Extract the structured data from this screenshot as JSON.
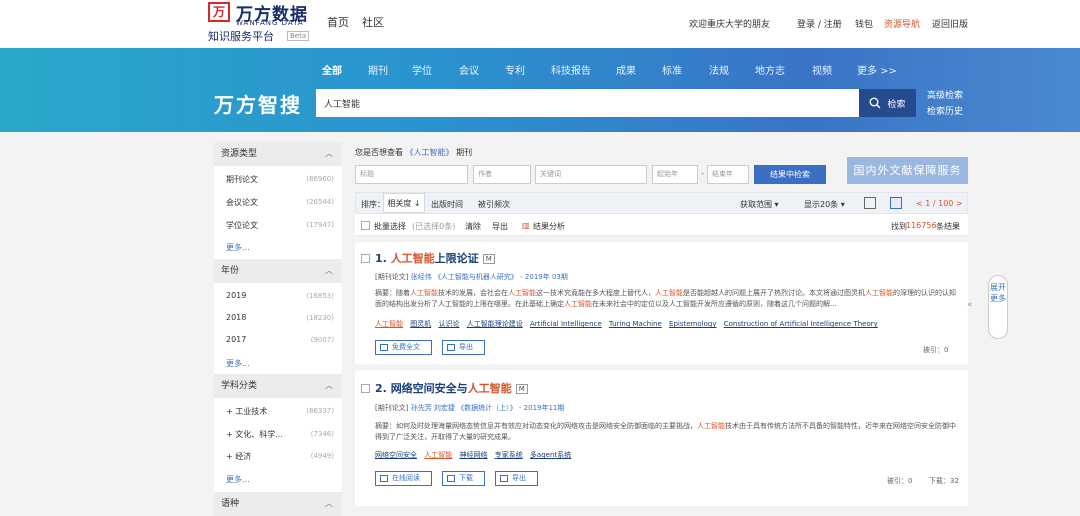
{
  "logo": {
    "mark": "万",
    "cn": "万方数据",
    "en": "WANFANG DATA",
    "sub": "知识服务平台",
    "ver": "Beta"
  },
  "top_nav": [
    "首页",
    "社区"
  ],
  "top_right": {
    "welcome": "欢迎重庆大学的朋友",
    "login": "登录 / 注册",
    "wallet": "钱包",
    "resource": "资源导航",
    "back": "返回旧版"
  },
  "categories": [
    "全部",
    "期刊",
    "学位",
    "会议",
    "专利",
    "科技报告",
    "成果",
    "标准",
    "法规",
    "地方志",
    "视频",
    "更多 >>"
  ],
  "brand": "万方智搜",
  "search": {
    "value": "人工智能",
    "button": "检索",
    "advanced": "高级检索",
    "history": "检索历史"
  },
  "sidebar": {
    "sections": [
      {
        "title": "资源类型",
        "items": [
          {
            "label": "期刊论文",
            "count": "(86960)"
          },
          {
            "label": "会议论文",
            "count": "(26544)"
          },
          {
            "label": "学位论文",
            "count": "(17947)"
          }
        ],
        "more": "更多..."
      },
      {
        "title": "年份",
        "items": [
          {
            "label": "2019",
            "count": "(16853)"
          },
          {
            "label": "2018",
            "count": "(18230)"
          },
          {
            "label": "2017",
            "count": "(9007)"
          }
        ],
        "more": "更多..."
      },
      {
        "title": "学科分类",
        "items": [
          {
            "label": "+ 工业技术",
            "count": "(86337)"
          },
          {
            "label": "+ 文化、科学...",
            "count": "(7346)"
          },
          {
            "label": "+ 经济",
            "count": "(4949)"
          }
        ],
        "more": "更多..."
      },
      {
        "title": "语种"
      }
    ]
  },
  "breadcrumb": {
    "prefix": "您是否想查看",
    "term": "《人工智能》",
    "suffix": "期刊"
  },
  "filters": {
    "title": "标题",
    "author": "作者",
    "keyword": "关键词",
    "start_year": "起始年",
    "sep": "-",
    "end_year": "结束年",
    "button": "结果中检索"
  },
  "ext_button": "国内外文献保障服务",
  "sortbar": {
    "label": "排序：",
    "active": "相关度 ↓",
    "time": "出版时间",
    "cited": "被引频次",
    "range": "获取范围 ▾",
    "per_page": "显示20条 ▾",
    "pager": "< 1 / 100 >"
  },
  "actbar": {
    "batch": "批量选择",
    "selected": "(已选择0条)",
    "clear": "清除",
    "export": "导出",
    "analyze": "结果分析",
    "found_prefix": "找到",
    "found_count": "116756",
    "found_suffix": "条结果"
  },
  "results": [
    {
      "num": "1.",
      "title_hl": "人工智能",
      "title_rest": "上限论证",
      "badge": "M",
      "type": "[期刊论文]",
      "author": "张经伟",
      "journal": "《人工智能与机器人研究》",
      "date": "- 2019年 03期",
      "abs_a": "摘要：随着",
      "abs_b": "人工智能",
      "abs_c": "技术的发展，会社会在",
      "abs_d": "人工智能",
      "abs_e": "这一技术究竟能在多大程度上替代人，",
      "abs_f": "人工智能",
      "abs_g": "是否能超越人的问题上展开了热烈讨论。本文将通过图灵机",
      "abs_h": "人工智能",
      "abs_i": "的深理的认识的认知面的结构出发分析了人工智能的上限在哪里。在此基础上确定",
      "abs_j": "人工智能",
      "abs_k": "在未来社会中的定位以及人工智能开发所应遵循的原则，随着这几个问题的解...",
      "keywords_hl": "人工智能",
      "keywords": [
        "图灵机",
        "认识论",
        "人工智能理论建设",
        "Artificial Intelligence",
        "Turing Machine",
        "Epistemology",
        "Construction of Artificial Intelligence Theory"
      ],
      "btn1": "免费全文",
      "btn2": "导出",
      "stat1": "被引：0",
      "stat2": ""
    },
    {
      "num": "2.",
      "title_pre": "网络空间安全与",
      "title_hl": "人工智能",
      "badge": "M",
      "type": "[期刊论文]",
      "author": "孙先芳 刘宏捷",
      "journal": "《数据统计（上）》",
      "date": "- 2019年11期",
      "abs_a": "摘要：如何及时处理海量网络态势信息并有效应对动态变化的网络攻击是网络安全防御面临的主要挑战，",
      "abs_b": "人工智能",
      "abs_c": "技术由于具有传统方法所不具备的智能特性，近年来在网络空间安全防御中得到了广泛关注，开取得了大量的研究成果。",
      "keywords": [
        "网络空间安全",
        "人工智能",
        "神经网络",
        "专家系统",
        "多agent系统"
      ],
      "btn1": "在线阅读",
      "btn2": "下载",
      "btn3": "导出",
      "stat1": "被引：0",
      "stat2": "下载：32"
    }
  ],
  "expand": "展开更多"
}
